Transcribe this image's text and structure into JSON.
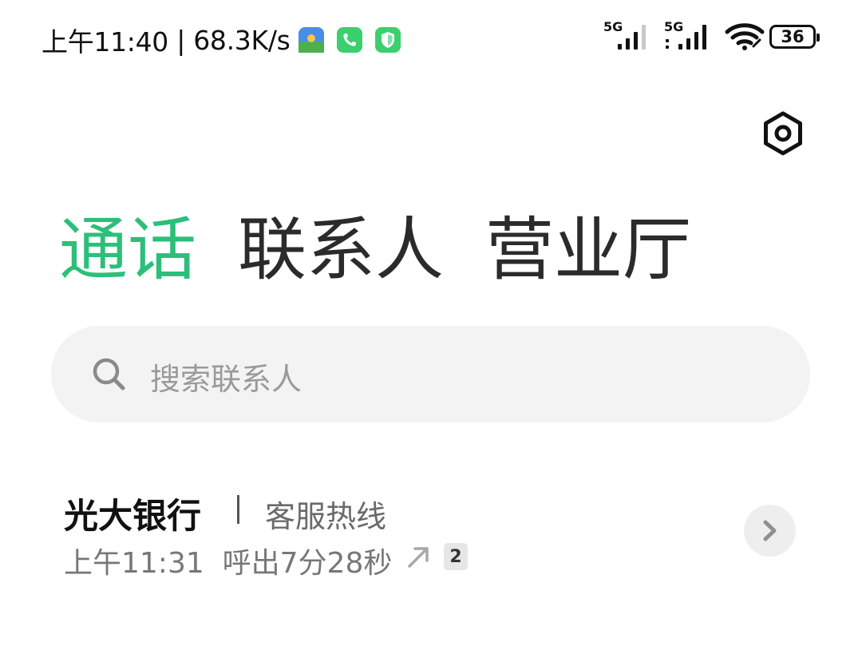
{
  "status_bar": {
    "time": "上午11:40",
    "network_speed": "68.3K/s",
    "battery": "36",
    "signal_1_label": "5G",
    "signal_2_label": "5G",
    "notification_icons": [
      "gallery-app-icon",
      "phone-app-icon",
      "security-shield-icon"
    ]
  },
  "header": {
    "settings_icon": "gear-icon"
  },
  "tabs": [
    {
      "label": "通话",
      "active": true
    },
    {
      "label": "联系人",
      "active": false
    },
    {
      "label": "营业厅",
      "active": false
    }
  ],
  "search": {
    "placeholder": "搜索联系人",
    "icon": "search-icon"
  },
  "call_log": [
    {
      "name": "光大银行",
      "label": "客服热线",
      "time": "上午11:31",
      "detail": "呼出7分28秒",
      "direction_icon": "outgoing-call-icon",
      "sim": "2"
    }
  ],
  "colors": {
    "accent": "#2cbf7a",
    "text_primary": "#111111",
    "text_secondary": "#777777",
    "search_bg": "#f3f3f3"
  }
}
